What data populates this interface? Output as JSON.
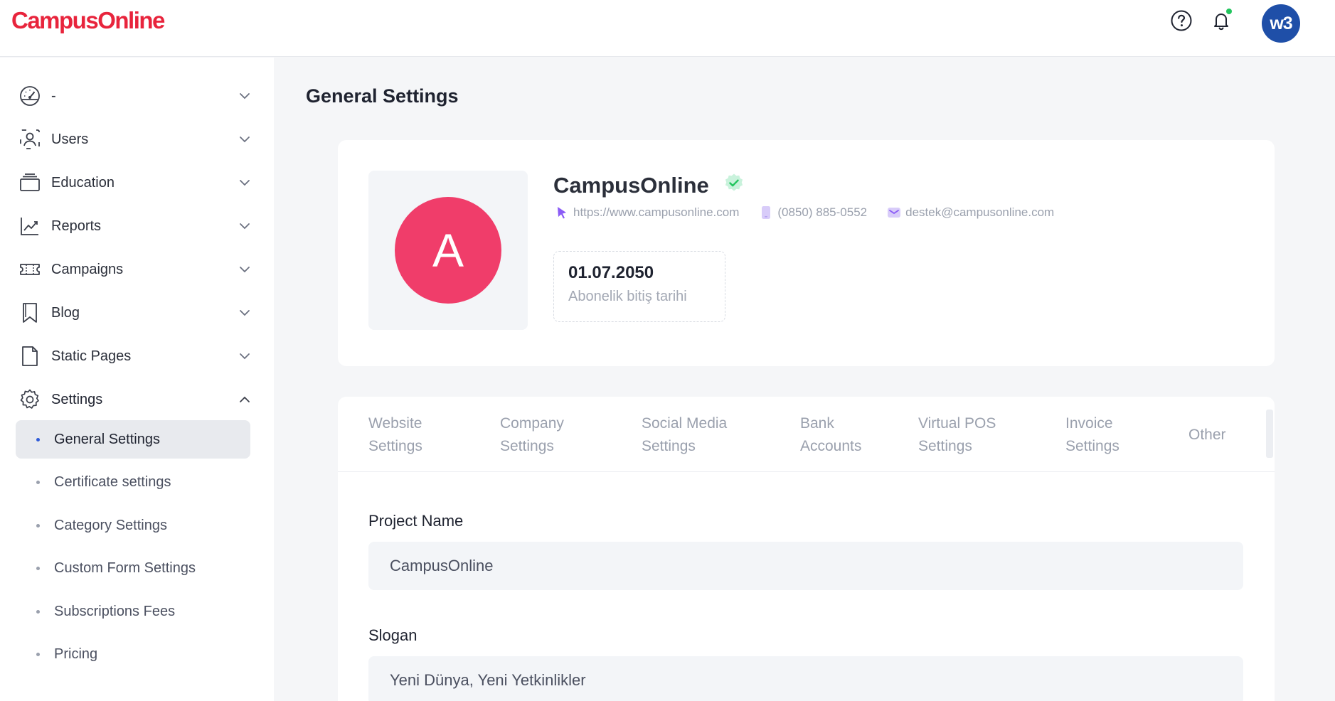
{
  "header": {
    "logo": "CampusOnline",
    "avatar_initials": "w3"
  },
  "sidebar": {
    "items": [
      {
        "label": "-",
        "icon": "dashboard-icon"
      },
      {
        "label": "Users",
        "icon": "users-icon"
      },
      {
        "label": "Education",
        "icon": "education-icon"
      },
      {
        "label": "Reports",
        "icon": "reports-icon"
      },
      {
        "label": "Campaigns",
        "icon": "ticket-icon"
      },
      {
        "label": "Blog",
        "icon": "bookmark-icon"
      },
      {
        "label": "Static Pages",
        "icon": "file-icon"
      },
      {
        "label": "Settings",
        "icon": "gear-icon"
      }
    ],
    "sub_items": [
      {
        "label": "General Settings",
        "active": true
      },
      {
        "label": "Certificate settings"
      },
      {
        "label": "Category Settings"
      },
      {
        "label": "Custom Form Settings"
      },
      {
        "label": "Subscriptions Fees"
      },
      {
        "label": "Pricing"
      }
    ]
  },
  "main": {
    "title": "General Settings",
    "profile": {
      "avatar_letter": "A",
      "name": "CampusOnline",
      "website": "https://www.campusonline.com",
      "phone": "(0850) 885-0552",
      "email": "destek@campusonline.com",
      "date_value": "01.07.2050",
      "date_label": "Abonelik bitiş tarihi"
    },
    "tabs": [
      {
        "line1": "Website",
        "line2": "Settings"
      },
      {
        "line1": "Company",
        "line2": "Settings"
      },
      {
        "line1": "Social Media",
        "line2": "Settings"
      },
      {
        "line1": "Bank",
        "line2": "Accounts"
      },
      {
        "line1": "Virtual POS",
        "line2": "Settings"
      },
      {
        "line1": "Invoice",
        "line2": "Settings"
      },
      {
        "line1": "Other",
        "line2": ""
      }
    ],
    "fields": {
      "project_name_label": "Project Name",
      "project_name_value": "CampusOnline",
      "slogan_label": "Slogan",
      "slogan_value": "Yeni Dünya, Yeni Yetkinlikler"
    }
  },
  "colors": {
    "brand": "#e8243c",
    "avatar": "#f03d6a",
    "accent": "#2f5bd8",
    "verified": "#22c55e",
    "contact_icon": "#8b5cf6"
  }
}
